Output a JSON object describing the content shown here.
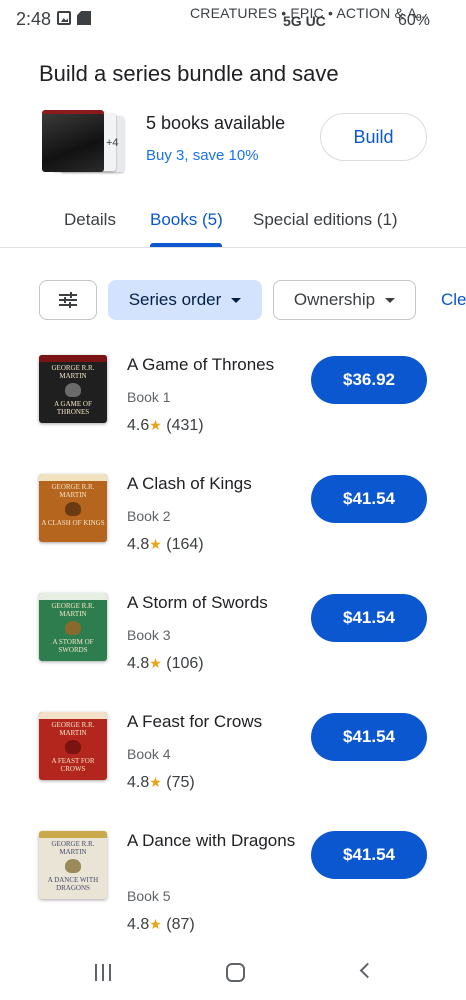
{
  "status_bar": {
    "time": "2:48",
    "ticker": "CREATURES • EPIC • ACTION & A...",
    "network": "5G UC",
    "battery": "60%"
  },
  "bundle": {
    "title": "Build a series bundle and save",
    "extra_count": "+4",
    "count_text": "5 books available",
    "promo": "Buy 3, save 10%",
    "build_label": "Build"
  },
  "tabs": [
    {
      "label": "Details",
      "active": false
    },
    {
      "label": "Books (5)",
      "active": true
    },
    {
      "label": "Special editions (1)",
      "active": false
    }
  ],
  "filters": {
    "sort_label": "Series order",
    "ownership_label": "Ownership",
    "clear_label": "Cle"
  },
  "books": [
    {
      "title": "A Game of Thrones",
      "series_index": "Book 1",
      "rating": "4.6",
      "reviews": "(431)",
      "price": "$36.92",
      "cover_author": "GEORGE R.R. MARTIN",
      "cover_title": "A GAME OF THRONES",
      "cover_color": "#1f1f1f"
    },
    {
      "title": "A Clash of Kings",
      "series_index": "Book 2",
      "rating": "4.8",
      "reviews": "(164)",
      "price": "$41.54",
      "cover_author": "GEORGE R.R. MARTIN",
      "cover_title": "A CLASH OF KINGS",
      "cover_color": "#b5651d"
    },
    {
      "title": "A Storm of Swords",
      "series_index": "Book 3",
      "rating": "4.8",
      "reviews": "(106)",
      "price": "$41.54",
      "cover_author": "GEORGE R.R. MARTIN",
      "cover_title": "A STORM OF SWORDS",
      "cover_color": "#2e7d4f"
    },
    {
      "title": "A Feast for Crows",
      "series_index": "Book 4",
      "rating": "4.8",
      "reviews": "(75)",
      "price": "$41.54",
      "cover_author": "GEORGE R.R. MARTIN",
      "cover_title": "A FEAST FOR CROWS",
      "cover_color": "#b3261e"
    },
    {
      "title": "A Dance with Dragons",
      "series_index": "Book 5",
      "rating": "4.8",
      "reviews": "(87)",
      "price": "$41.54",
      "cover_author": "GEORGE R.R. MARTIN",
      "cover_title": "A DANCE WITH DRAGONS",
      "cover_color": "#e9e4d6"
    }
  ],
  "colors": {
    "accent": "#0b57d0",
    "chip_selected": "#d3e3fd",
    "star": "#e8a317"
  }
}
